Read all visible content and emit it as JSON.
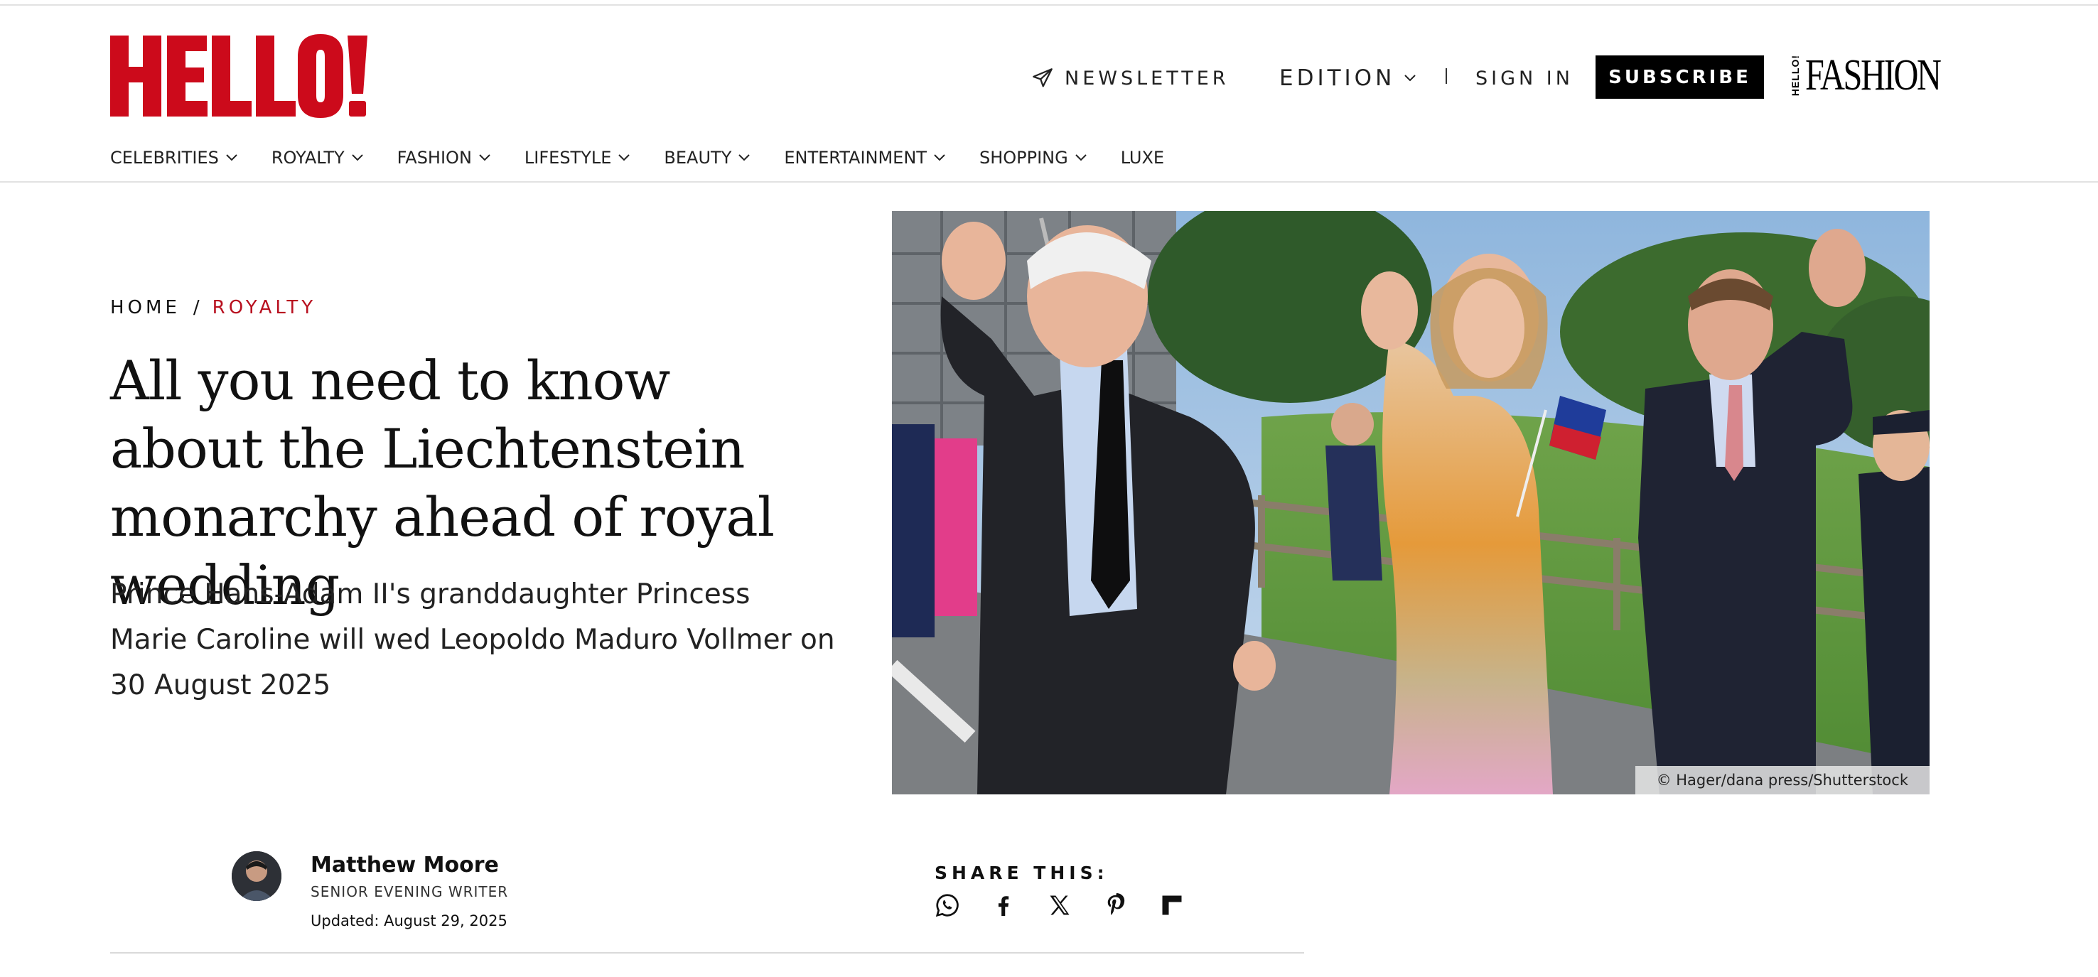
{
  "brand": {
    "logo_text": "HELLO!",
    "logo_color": "#cc0a1b",
    "fashion_logo_mini": "HELLO!",
    "fashion_logo_word": "FASHION"
  },
  "header": {
    "newsletter_label": "NEWSLETTER",
    "edition_label": "EDITION",
    "signin_label": "SIGN IN",
    "subscribe_label": "SUBSCRIBE"
  },
  "nav": {
    "items": [
      {
        "label": "CELEBRITIES",
        "has_dropdown": true
      },
      {
        "label": "ROYALTY",
        "has_dropdown": true
      },
      {
        "label": "FASHION",
        "has_dropdown": true
      },
      {
        "label": "LIFESTYLE",
        "has_dropdown": true
      },
      {
        "label": "BEAUTY",
        "has_dropdown": true
      },
      {
        "label": "ENTERTAINMENT",
        "has_dropdown": true
      },
      {
        "label": "SHOPPING",
        "has_dropdown": true
      },
      {
        "label": "LUXE",
        "has_dropdown": false
      }
    ]
  },
  "article": {
    "breadcrumb": {
      "home": "HOME",
      "separator": "/",
      "section": "ROYALTY",
      "section_color": "#b8101f"
    },
    "headline": "All you need to know about the Liechtenstein monarchy ahead of royal wedding",
    "standfirst": "Prince Hans-Adam II's granddaughter Princess Marie Caroline will wed Leopoldo Maduro Vollmer on 30 August 2025",
    "image_credit": "© Hager/dana press/Shutterstock",
    "author": {
      "name": "Matthew Moore",
      "role": "SENIOR EVENING WRITER",
      "updated": "Updated: August 29, 2025"
    },
    "share": {
      "label": "SHARE THIS:",
      "icons": [
        "whatsapp-icon",
        "facebook-icon",
        "x-icon",
        "pinterest-icon",
        "flipboard-icon"
      ]
    }
  }
}
